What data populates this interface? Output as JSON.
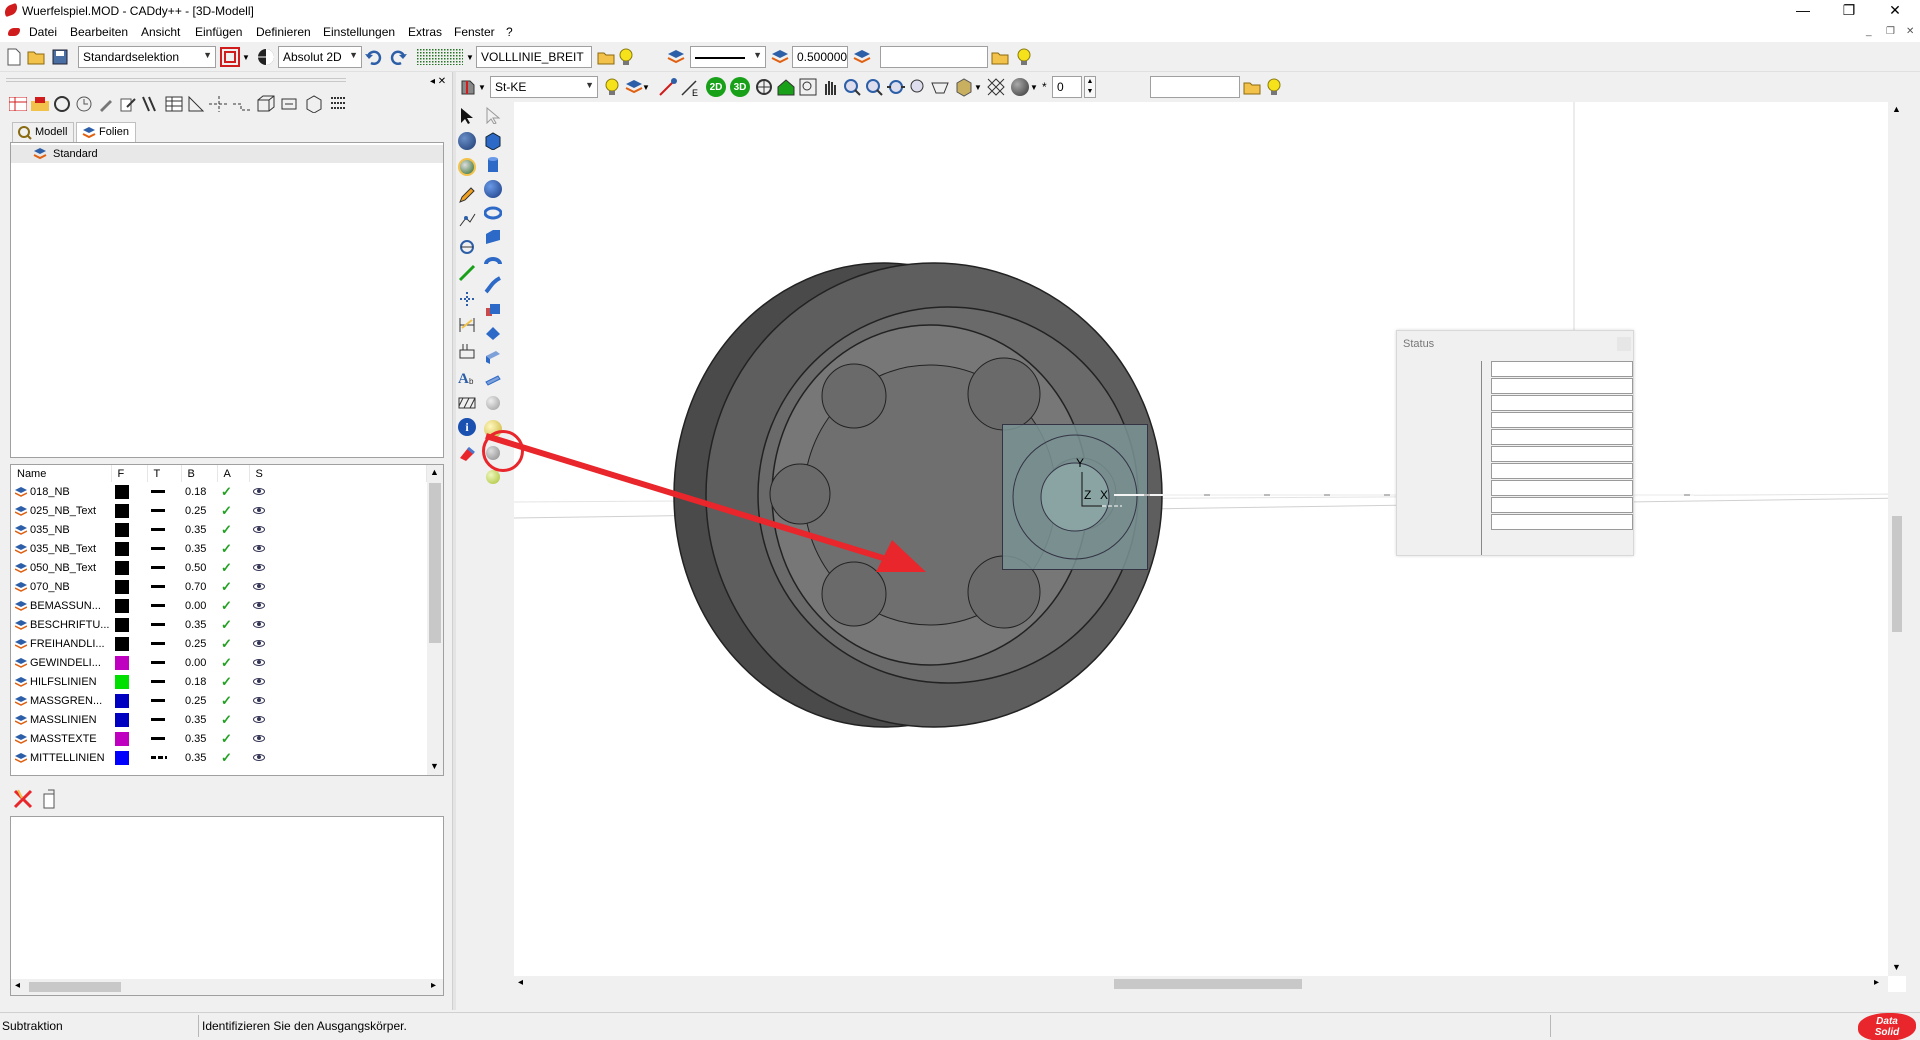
{
  "window": {
    "title": "Wuerfelspiel.MOD  -  CADdy++ - [3D-Modell]",
    "minimize": "—",
    "restore": "❐",
    "close": "✕"
  },
  "menu": {
    "items": [
      "Datei",
      "Bearbeiten",
      "Ansicht",
      "Einfügen",
      "Definieren",
      "Einstellungen",
      "Extras",
      "Fenster",
      "?"
    ]
  },
  "toolbar1": {
    "selection_mode": "Standardselektion",
    "coord_mode": "Absolut 2D",
    "line_layer": "VOLLLINIE_BREIT",
    "line_width": "0.500000",
    "search_value": ""
  },
  "toolbar2": {
    "material": "St-KE",
    "btn_2d": "2D",
    "btn_3d": "3D",
    "counter_value": "0",
    "field_value": ""
  },
  "left_panel": {
    "tabs": [
      {
        "label": "Modell"
      },
      {
        "label": "Folien"
      }
    ],
    "tree": {
      "root_label": "Standard"
    },
    "layer_table": {
      "columns": [
        "Name",
        "F",
        "T",
        "B",
        "A",
        "S"
      ],
      "rows": [
        {
          "name": "018_NB",
          "color": "#000000",
          "line": "solid",
          "width": "0.18"
        },
        {
          "name": "025_NB_Text",
          "color": "#000000",
          "line": "solid",
          "width": "0.25"
        },
        {
          "name": "035_NB",
          "color": "#000000",
          "line": "solid",
          "width": "0.35"
        },
        {
          "name": "035_NB_Text",
          "color": "#000000",
          "line": "solid",
          "width": "0.35"
        },
        {
          "name": "050_NB_Text",
          "color": "#000000",
          "line": "solid",
          "width": "0.50"
        },
        {
          "name": "070_NB",
          "color": "#000000",
          "line": "solid",
          "width": "0.70"
        },
        {
          "name": "BEMASSUN...",
          "color": "#000000",
          "line": "solid",
          "width": "0.00"
        },
        {
          "name": "BESCHRIFTU...",
          "color": "#000000",
          "line": "solid",
          "width": "0.35"
        },
        {
          "name": "FREIHANDLI...",
          "color": "#000000",
          "line": "solid",
          "width": "0.25"
        },
        {
          "name": "GEWINDELI...",
          "color": "#c000c0",
          "line": "solid",
          "width": "0.00"
        },
        {
          "name": "HILFSLINIEN",
          "color": "#00e000",
          "line": "solid",
          "width": "0.18"
        },
        {
          "name": "MASSGREN...",
          "color": "#0000c0",
          "line": "solid",
          "width": "0.25"
        },
        {
          "name": "MASSLINIEN",
          "color": "#0000c0",
          "line": "solid",
          "width": "0.35"
        },
        {
          "name": "MASSTEXTE",
          "color": "#c000c0",
          "line": "solid",
          "width": "0.35"
        },
        {
          "name": "MITTELLINIEN",
          "color": "#0000ff",
          "line": "dashdot",
          "width": "0.35"
        }
      ]
    }
  },
  "status_dialog": {
    "title": "Status"
  },
  "viewport": {
    "axis_labels": {
      "y": "Y",
      "z": "Z",
      "x": "X"
    }
  },
  "statusbar": {
    "command": "Subtraktion",
    "prompt": "Identifizieren Sie den Ausgangskörper.",
    "brand_line1": "Data",
    "brand_line2": "Solid"
  },
  "colors": {
    "accent_red": "#e8262b",
    "model_dark": "#4d4d4d",
    "model_mid": "#6e6e6e",
    "selection": "#7a9494"
  }
}
